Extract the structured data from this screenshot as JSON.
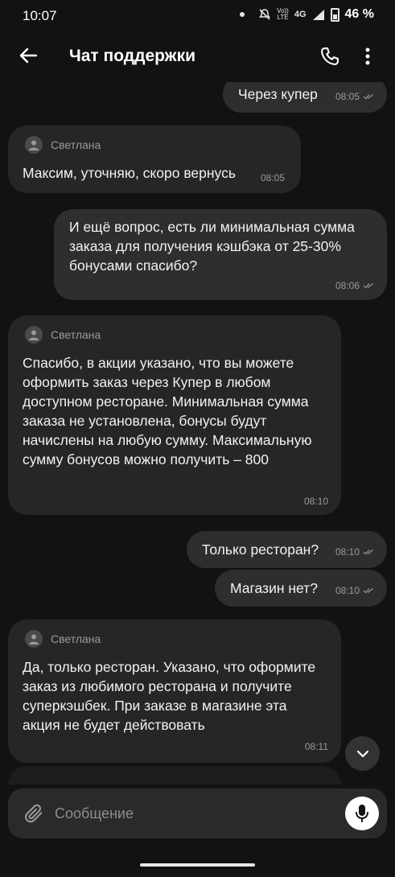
{
  "status_bar": {
    "time": "10:07",
    "volte_top": "Vo))",
    "volte_bottom": "LTE",
    "network": "4G",
    "battery_percent": "46 %"
  },
  "header": {
    "title": "Чат поддержки",
    "icons": [
      "back-arrow-icon",
      "phone-icon",
      "more-vertical-icon"
    ]
  },
  "messages": [
    {
      "direction": "out",
      "text": "Через купер",
      "time": "08:05",
      "read": true
    },
    {
      "direction": "in",
      "sender": "Светлана",
      "text": "Максим, уточняю, скоро вернусь",
      "time": "08:05"
    },
    {
      "direction": "out",
      "text": "И ещё вопрос, есть ли минимальная сумма заказа для получения кэшбэка от 25-30% бонусами спасибо?",
      "time": "08:06",
      "read": true
    },
    {
      "direction": "in",
      "sender": "Светлана",
      "text": "Спасибо, в акции указано, что вы можете оформить заказ через Купер в любом доступном ресторане. Минимальная сумма заказа не установлена, бонусы будут начислены на любую сумму. Максимальную сумму бонусов можно получить – 800",
      "time": "08:10"
    },
    {
      "direction": "out",
      "text": "Только ресторан?",
      "time": "08:10",
      "read": true
    },
    {
      "direction": "out",
      "text": "Магазин нет?",
      "time": "08:10",
      "read": true
    },
    {
      "direction": "in",
      "sender": "Светлана",
      "text": "Да, только ресторан. Указано, что оформите заказ из любимого ресторана и получите суперкэшбек. При заказе в магазине эта акция не будет действовать",
      "time": "08:11"
    }
  ],
  "composer": {
    "placeholder": "Сообщение"
  },
  "colors": {
    "background": "#121212",
    "bubble_out": "#2e2e2e",
    "bubble_in": "#262626",
    "meta_text": "#9a9a9a"
  }
}
